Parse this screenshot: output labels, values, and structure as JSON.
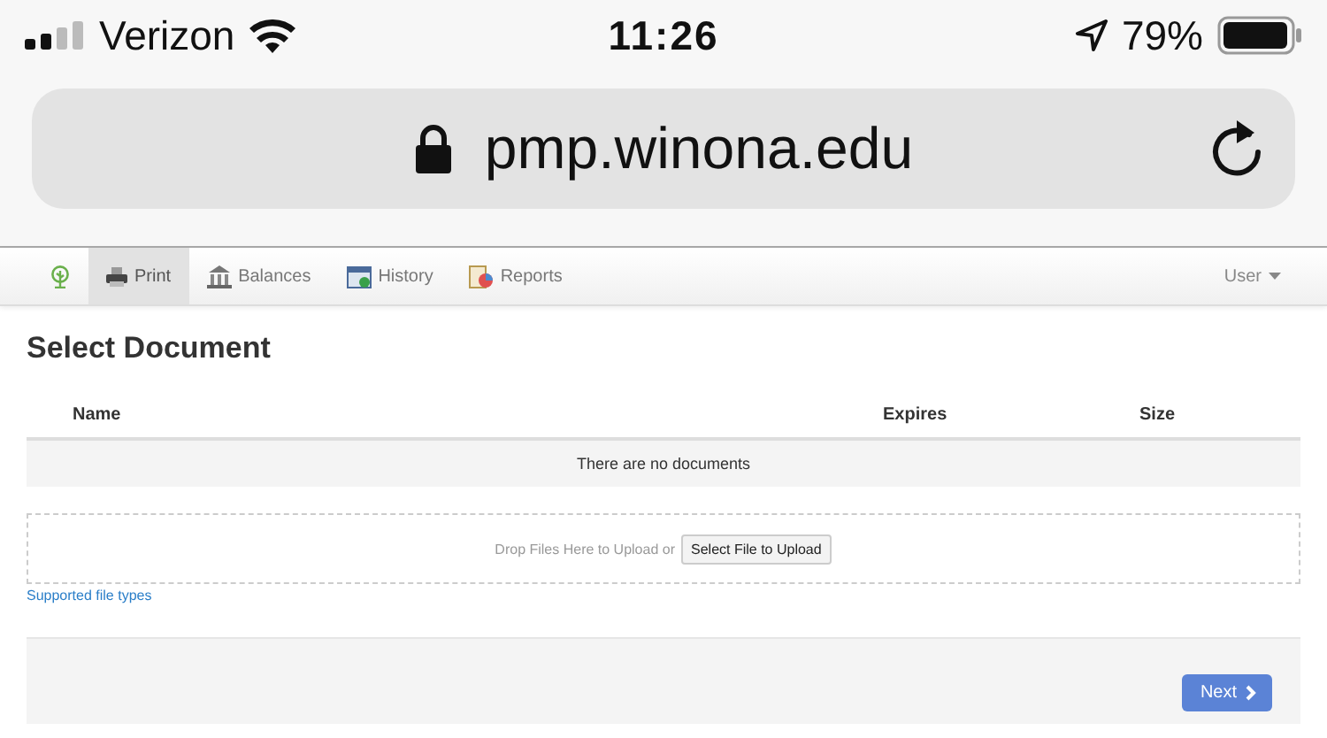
{
  "status_bar": {
    "carrier": "Verizon",
    "time": "11:26",
    "battery": "79%"
  },
  "address_bar": {
    "url": "pmp.winona.edu"
  },
  "nav": {
    "tabs": [
      {
        "kind": "home",
        "selected": false
      },
      {
        "kind": "print",
        "label": "Print",
        "selected": true
      },
      {
        "kind": "balances",
        "label": "Balances",
        "selected": false
      },
      {
        "kind": "history",
        "label": "History",
        "selected": false
      },
      {
        "kind": "reports",
        "label": "Reports",
        "selected": false
      }
    ],
    "user_menu": "User"
  },
  "page": {
    "title": "Select Document",
    "table": {
      "columns": [
        "Name",
        "Expires",
        "Size"
      ],
      "empty_message": "There are no documents"
    },
    "upload": {
      "hint": "Drop Files Here to Upload or",
      "button": "Select File to Upload"
    },
    "link": "Supported file types",
    "next_button": "Next"
  }
}
